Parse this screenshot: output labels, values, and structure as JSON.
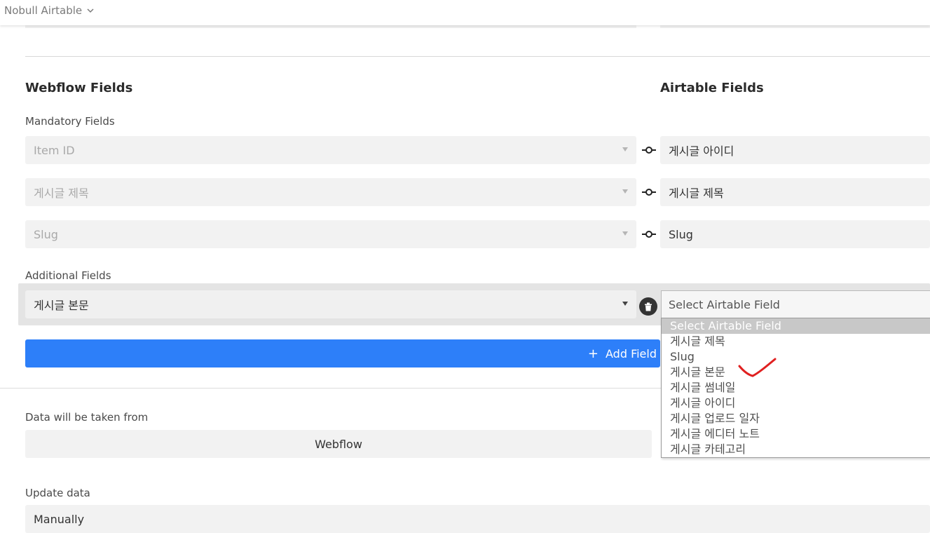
{
  "header": {
    "app_name": "Nobull Airtable"
  },
  "mapping": {
    "webflow_heading": "Webflow Fields",
    "airtable_heading": "Airtable Fields",
    "mandatory_label": "Mandatory Fields",
    "mandatory": [
      {
        "webflow": "Item ID",
        "airtable": "게시글 아이디"
      },
      {
        "webflow": "게시글 제목",
        "airtable": "게시글 제목"
      },
      {
        "webflow": "Slug",
        "airtable": "Slug"
      }
    ],
    "additional_label": "Additional Fields",
    "additional": {
      "webflow": "게시글 본문",
      "airtable_placeholder": "Select Airtable Field"
    },
    "add_field_label": "Add Field"
  },
  "dropdown": {
    "options": [
      "Select Airtable Field",
      "게시글 제목",
      "Slug",
      "게시글 본문",
      "게시글 썸네일",
      "게시글 아이디",
      "게시글 업로드 일자",
      "게시글 에디터 노트",
      "게시글 카테고리"
    ],
    "selected_index": 0,
    "annotation_color": "#e02020"
  },
  "source": {
    "label": "Data will be taken from",
    "value": "Webflow"
  },
  "update": {
    "label": "Update data",
    "value": "Manually"
  },
  "colors": {
    "primary": "#2d7ff9",
    "field_bg": "#f2f2f2"
  }
}
